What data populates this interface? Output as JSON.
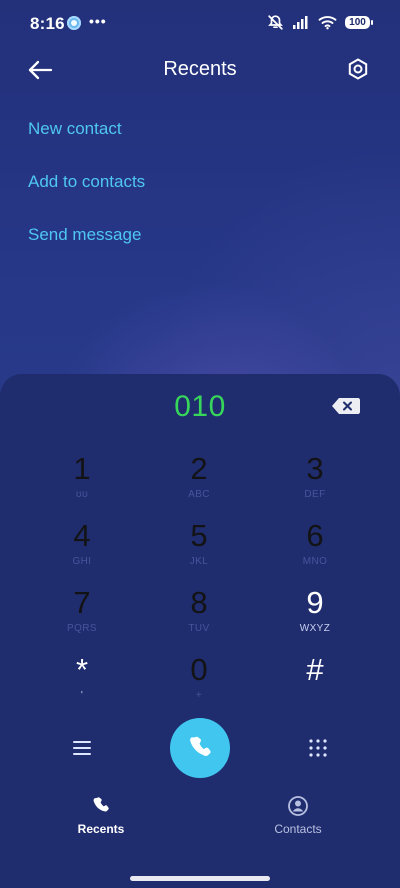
{
  "status_bar": {
    "time": "8:16",
    "more": "•••",
    "battery": "100"
  },
  "header": {
    "title": "Recents"
  },
  "actions": [
    {
      "label": "New contact"
    },
    {
      "label": "Add to contacts"
    },
    {
      "label": "Send message"
    }
  ],
  "dialer": {
    "input_value": "010",
    "keys": [
      {
        "main": "1",
        "sub": "ʊʊ"
      },
      {
        "main": "2",
        "sub": "ABC"
      },
      {
        "main": "3",
        "sub": "DEF"
      },
      {
        "main": "4",
        "sub": "GHI"
      },
      {
        "main": "5",
        "sub": "JKL"
      },
      {
        "main": "6",
        "sub": "MNO"
      },
      {
        "main": "7",
        "sub": "PQRS"
      },
      {
        "main": "8",
        "sub": "TUV"
      },
      {
        "main": "9",
        "sub": "WXYZ"
      },
      {
        "main": "*",
        "sub": "'"
      },
      {
        "main": "0",
        "sub": "+"
      },
      {
        "main": "#",
        "sub": ""
      }
    ]
  },
  "bottom_nav": {
    "items": [
      {
        "label": "Recents",
        "icon": "phone-icon"
      },
      {
        "label": "Contacts",
        "icon": "contact-icon"
      }
    ]
  },
  "colors": {
    "accent": "#41c7ef",
    "link": "#4fc7f2",
    "number": "#37d65a",
    "panel": "#1f2d6f"
  }
}
